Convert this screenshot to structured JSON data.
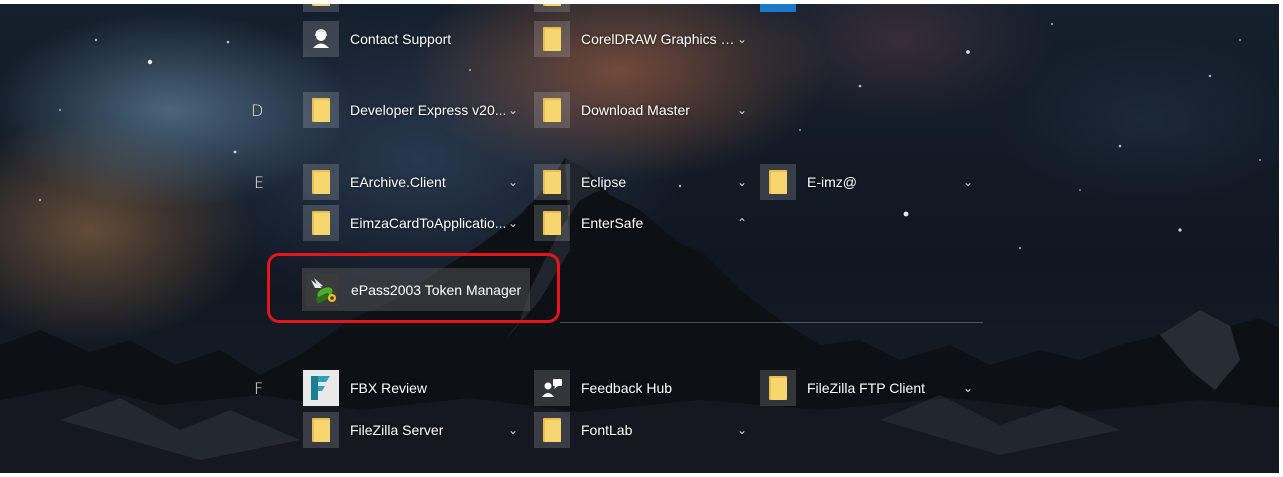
{
  "colors": {
    "folder": "#f7d56f",
    "highlight_ring": "#e8141b"
  },
  "groups": [
    {
      "letter": "",
      "items": [
        {
          "label": "Contact Support",
          "icon": "person-icon",
          "chevron": false
        },
        {
          "label": "CorelDRAW Graphics S...",
          "icon": "folder-icon",
          "chevron": true
        }
      ]
    },
    {
      "letter": "D",
      "items": [
        {
          "label": "Developer Express v20...",
          "icon": "folder-icon",
          "chevron": true
        },
        {
          "label": "Download Master",
          "icon": "folder-icon",
          "chevron": true
        }
      ]
    },
    {
      "letter": "E",
      "items": [
        {
          "label": "EArchive.Client",
          "icon": "folder-icon",
          "chevron": true
        },
        {
          "label": "Eclipse",
          "icon": "folder-icon",
          "chevron": true
        },
        {
          "label": "E-imz@",
          "icon": "folder-icon",
          "chevron": true
        },
        {
          "label": "EimzaCardToApplicatio...",
          "icon": "folder-icon",
          "chevron": true
        },
        {
          "label": "EnterSafe",
          "icon": "folder-icon",
          "chevron": true,
          "expanded": true
        }
      ]
    },
    {
      "letter": "F",
      "items": [
        {
          "label": "FBX Review",
          "icon": "fbx-review-icon",
          "chevron": false
        },
        {
          "label": "Feedback Hub",
          "icon": "feedback-hub-icon",
          "chevron": false
        },
        {
          "label": "FileZilla FTP Client",
          "icon": "folder-icon",
          "chevron": true
        },
        {
          "label": "FileZilla Server",
          "icon": "folder-icon",
          "chevron": true
        },
        {
          "label": "FontLab",
          "icon": "folder-icon",
          "chevron": true
        }
      ]
    }
  ],
  "expanded_folder_item": {
    "label": "ePass2003 Token Manager",
    "icon": "epass-token-icon"
  }
}
